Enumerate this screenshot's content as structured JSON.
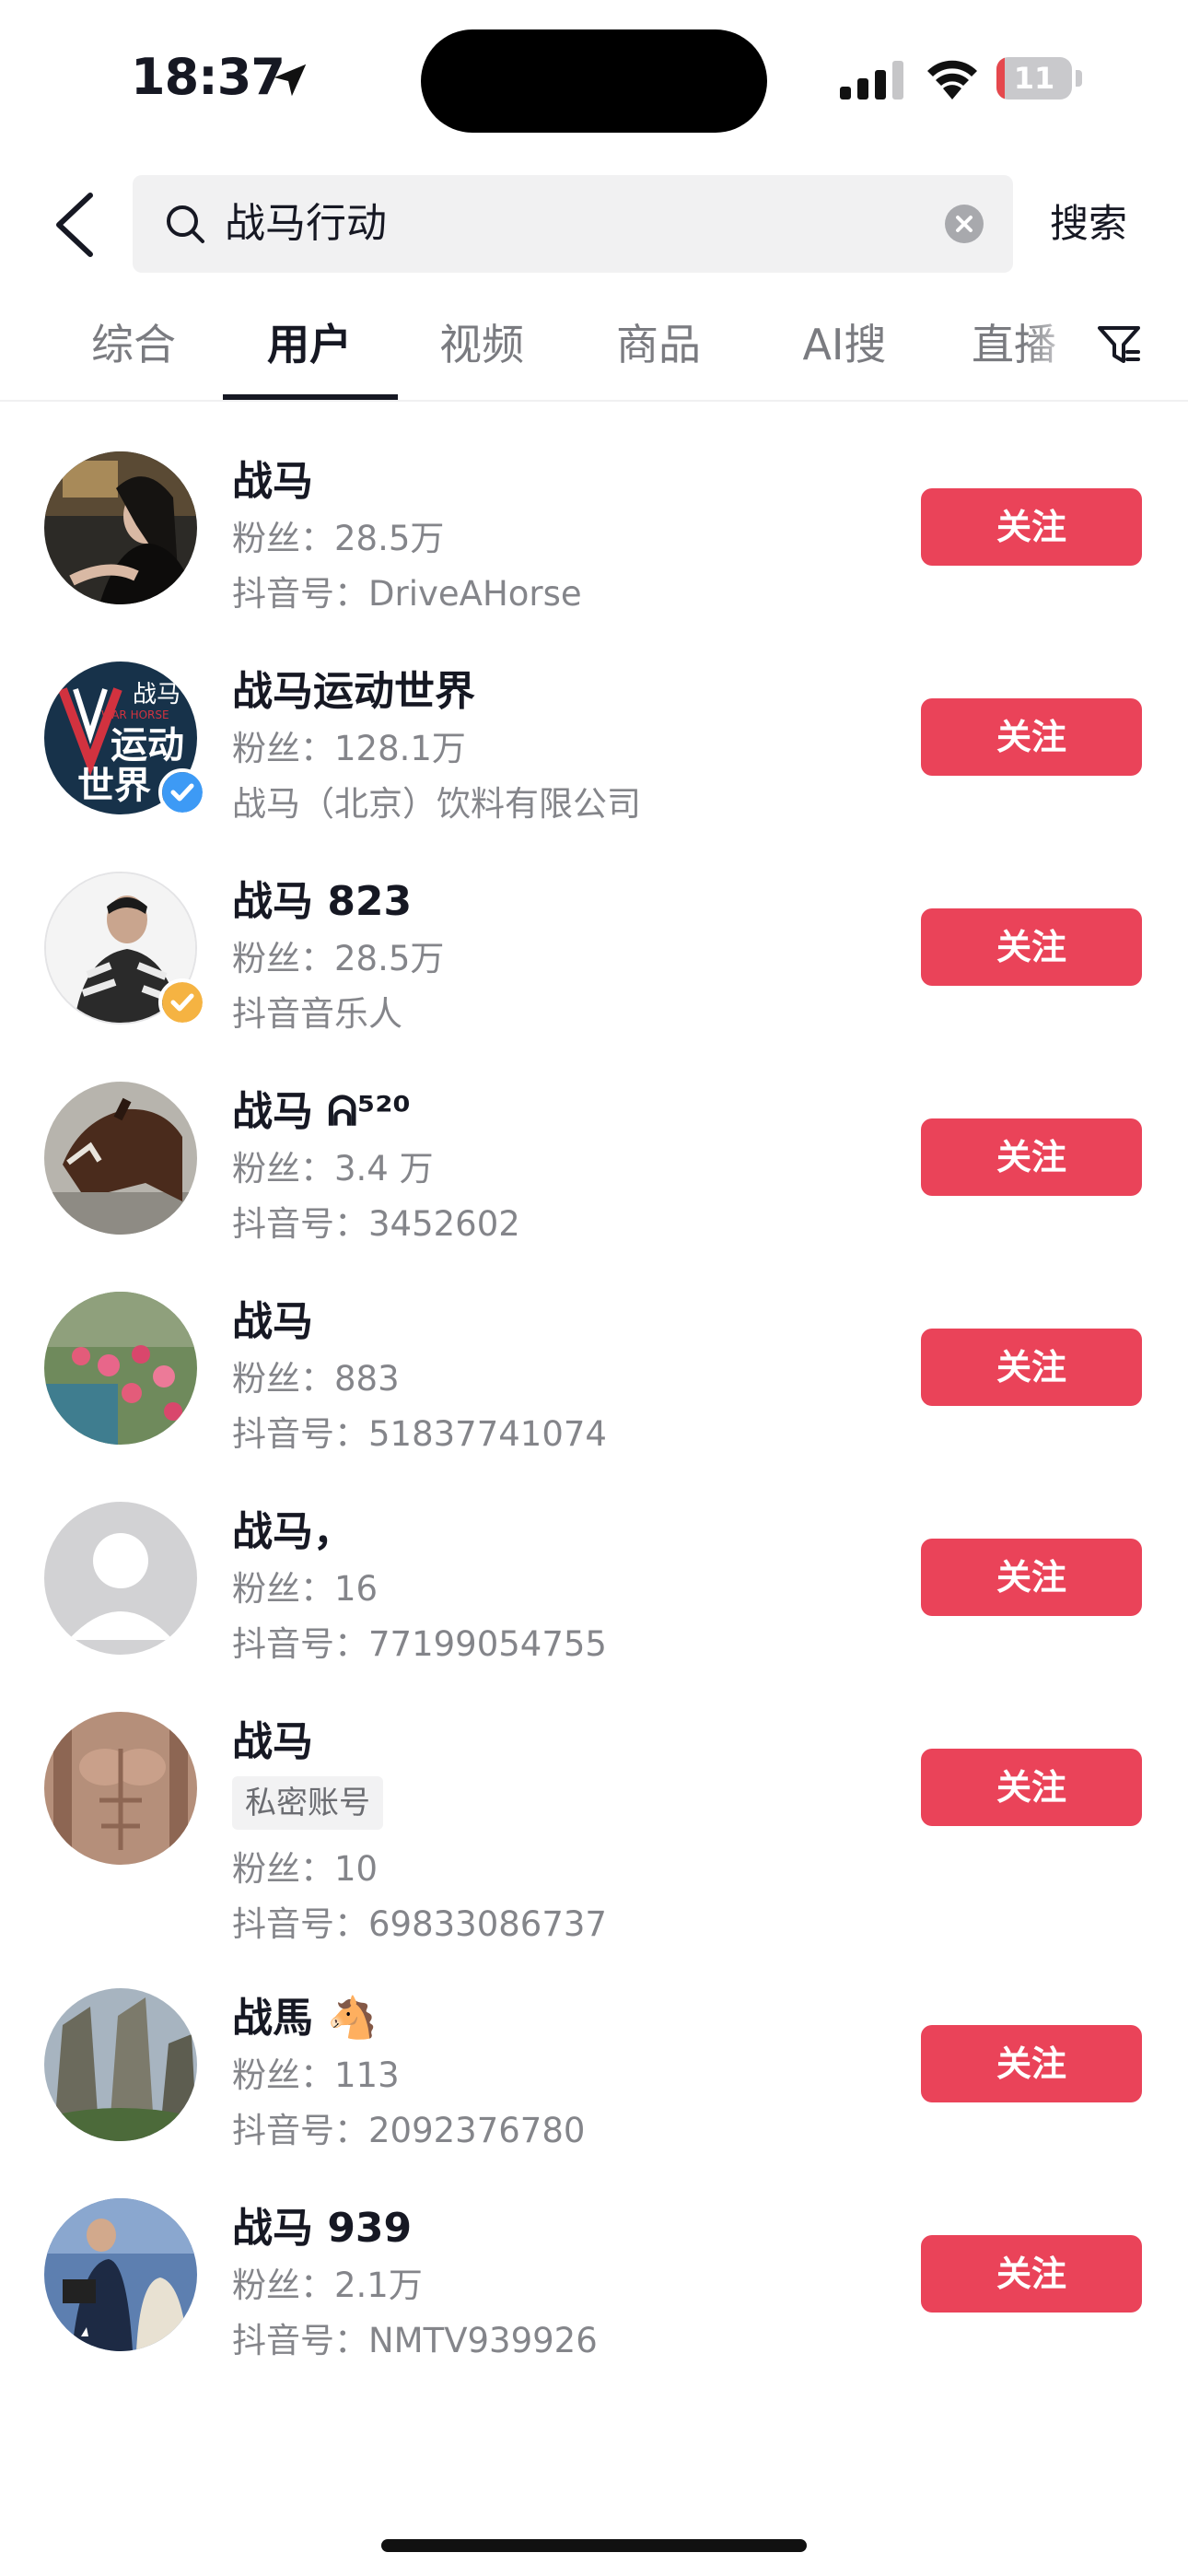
{
  "status_bar": {
    "time": "18:37",
    "battery_level": "11",
    "battery_fraction": 0.11,
    "icons": [
      "location-arrow-icon",
      "cellular-signal-icon",
      "wifi-icon",
      "battery-icon"
    ]
  },
  "search": {
    "query": "战马行动",
    "submit_label": "搜索",
    "icons": [
      "back-icon",
      "search-icon",
      "clear-icon"
    ]
  },
  "tabs": [
    {
      "label": "综合"
    },
    {
      "label": "用户"
    },
    {
      "label": "视频"
    },
    {
      "label": "商品"
    },
    {
      "label": "AI搜"
    },
    {
      "label": "直播"
    }
  ],
  "active_tab": "用户",
  "filter_icon": "filter-icon",
  "follow_label": "关注",
  "accent_color": "#ea4359",
  "users": [
    {
      "name": "战马",
      "fans": "粉丝：28.5万",
      "info": "抖音号：DriveAHorse"
    },
    {
      "name": "战马运动世界",
      "fans": "粉丝：128.1万",
      "info": "战马（北京）饮料有限公司",
      "badge": "blue-verified-badge",
      "avatar_text_top": "战马",
      "avatar_text_sub": "WAR HORSE",
      "avatar_text_main": "运动",
      "avatar_text_main2": "世界"
    },
    {
      "name": "战马 823",
      "fans": "粉丝：28.5万",
      "info": "抖音音乐人",
      "badge": "yellow-verified-badge"
    },
    {
      "name": "战马 ᕱ⁵²⁰",
      "fans": "粉丝：3.4 万",
      "info": "抖音号：3452602"
    },
    {
      "name": "战马",
      "fans": "粉丝：883",
      "info": "抖音号：51837741074"
    },
    {
      "name": "战马，",
      "fans": "粉丝：16",
      "info": "抖音号：77199054755"
    },
    {
      "name": "战马",
      "tag": "私密账号",
      "fans": "粉丝：10",
      "info": "抖音号：69833086737"
    },
    {
      "name": "战馬 🐴",
      "fans": "粉丝：113",
      "info": "抖音号：2092376780"
    },
    {
      "name": "战马 939",
      "fans": "粉丝：2.1万",
      "info": "抖音号：NMTV939926"
    }
  ]
}
